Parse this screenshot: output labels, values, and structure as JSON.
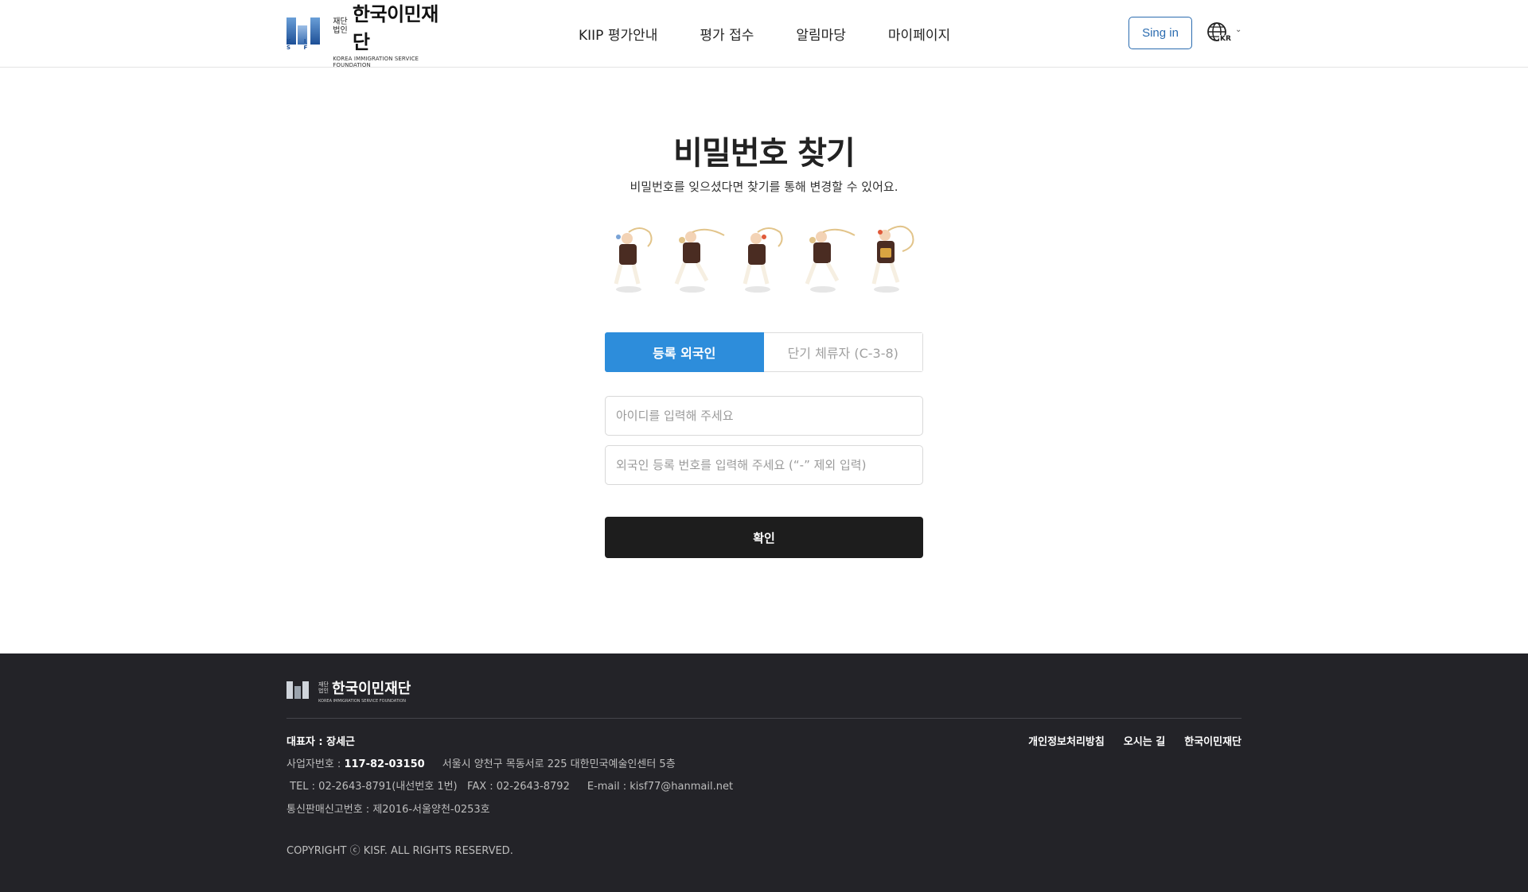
{
  "header": {
    "logo_small": "재단\n법인",
    "logo_name": "한국이민재단",
    "logo_eng": "KOREA IMMIGRATION SERVICE FOUNDATION",
    "logo_mark_text": "K I S F",
    "nav": [
      "KIIP 평가안내",
      "평가 접수",
      "알림마당",
      "마이페이지"
    ],
    "signin_label": "Sing in",
    "lang_label": "KR"
  },
  "main": {
    "title": "비밀번호 찾기",
    "subtitle": "비밀번호를 잊으셨다면 찾기를 통해 변경할 수 있어요.",
    "tabs": [
      {
        "label": "등록 외국인",
        "active": true
      },
      {
        "label": "단기 체류자 (C-3-8)",
        "active": false
      }
    ],
    "id_placeholder": "아이디를 입력해 주세요",
    "reg_placeholder": "외국인 등록 번호를 입력해 주세요 (“-” 제외 입력)",
    "confirm_label": "확인"
  },
  "footer": {
    "logo_name": "한국이민재단",
    "ceo": "대표자 : 장세근",
    "biz_label": "사업자번호 : ",
    "biz_no": "117-82-03150",
    "address": "서울시 양천구 목동서로 225 대한민국예술인센터 5층",
    "tel": "TEL : 02-2643-8791(내선번호 1번)",
    "fax": "FAX : 02-2643-8792",
    "email": "E-mail : kisf77@hanmail.net",
    "mail_order": "통신판매신고번호 : 제2016-서울양천-0253호",
    "copyright": "COPYRIGHT ⓒ KISF. ALL RIGHTS RESERVED.",
    "links": [
      "개인정보처리방침",
      "오시는 길",
      "한국이민재단"
    ]
  },
  "colors": {
    "primary": "#2d8ddb",
    "signin_border": "#2b6cb0",
    "confirm_bg": "#1d1d1d",
    "footer_bg": "#232328"
  }
}
